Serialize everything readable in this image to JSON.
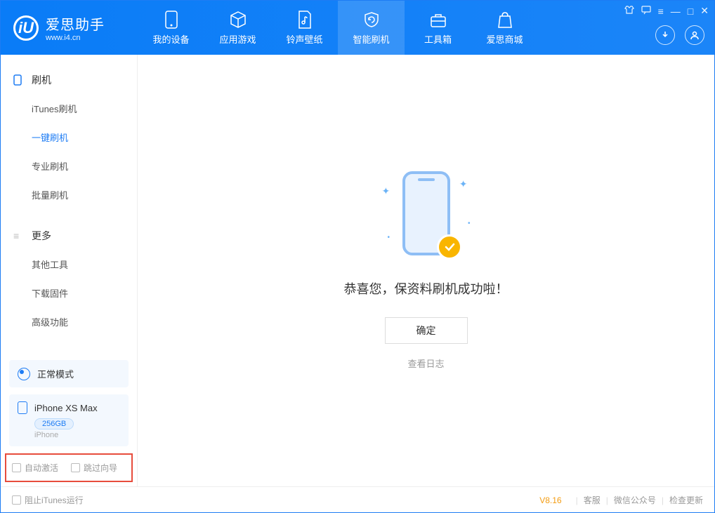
{
  "app": {
    "name_cn": "爱思助手",
    "url": "www.i4.cn"
  },
  "nav": {
    "items": [
      {
        "label": "我的设备"
      },
      {
        "label": "应用游戏"
      },
      {
        "label": "铃声壁纸"
      },
      {
        "label": "智能刷机"
      },
      {
        "label": "工具箱"
      },
      {
        "label": "爱思商城"
      }
    ]
  },
  "sidebar": {
    "group1_title": "刷机",
    "group1_items": [
      "iTunes刷机",
      "一键刷机",
      "专业刷机",
      "批量刷机"
    ],
    "group2_title": "更多",
    "group2_items": [
      "其他工具",
      "下载固件",
      "高级功能"
    ]
  },
  "device": {
    "mode": "正常模式",
    "name": "iPhone XS Max",
    "storage": "256GB",
    "type": "iPhone"
  },
  "options": {
    "auto_activate": "自动激活",
    "skip_wizard": "跳过向导"
  },
  "main": {
    "success": "恭喜您，保资料刷机成功啦！",
    "ok": "确定",
    "view_log": "查看日志"
  },
  "footer": {
    "block_itunes": "阻止iTunes运行",
    "version": "V8.16",
    "links": [
      "客服",
      "微信公众号",
      "检查更新"
    ]
  }
}
